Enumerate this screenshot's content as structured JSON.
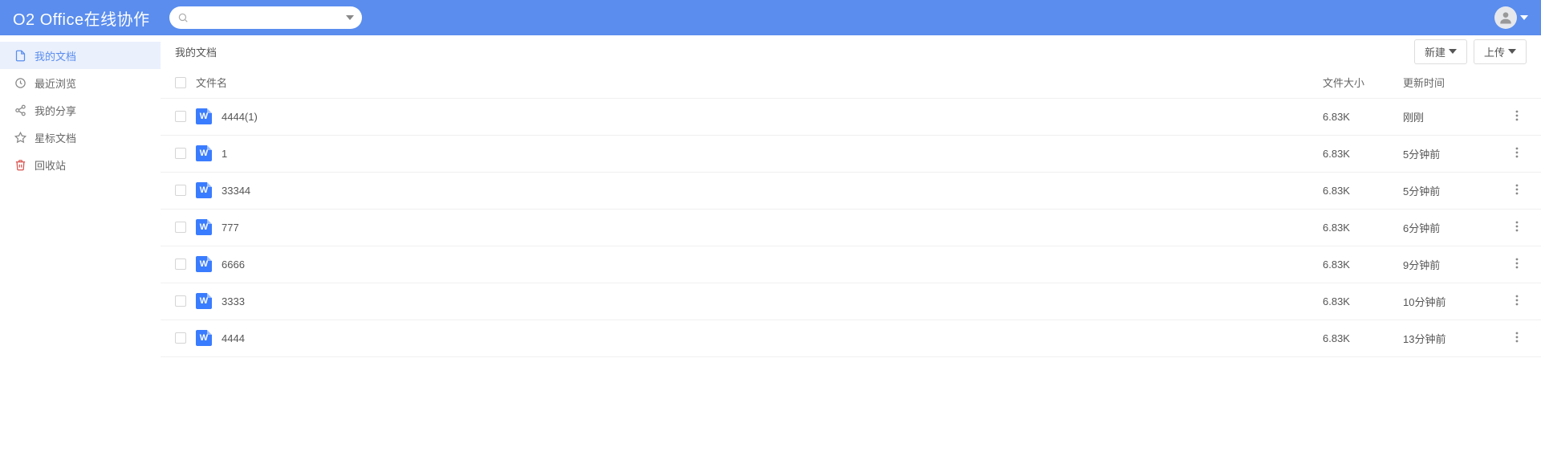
{
  "header": {
    "title": "O2 Office在线协作",
    "search_placeholder": ""
  },
  "sidebar": {
    "items": [
      {
        "label": "我的文档"
      },
      {
        "label": "最近浏览"
      },
      {
        "label": "我的分享"
      },
      {
        "label": "星标文档"
      },
      {
        "label": "回收站"
      }
    ]
  },
  "toolbar": {
    "breadcrumb": "我的文档",
    "new_label": "新建",
    "upload_label": "上传"
  },
  "table": {
    "headers": {
      "name": "文件名",
      "size": "文件大小",
      "time": "更新时间"
    },
    "rows": [
      {
        "name": "4444(1)",
        "size": "6.83K",
        "time": "刚刚"
      },
      {
        "name": "1",
        "size": "6.83K",
        "time": "5分钟前"
      },
      {
        "name": "33344",
        "size": "6.83K",
        "time": "5分钟前"
      },
      {
        "name": "777",
        "size": "6.83K",
        "time": "6分钟前"
      },
      {
        "name": "6666",
        "size": "6.83K",
        "time": "9分钟前"
      },
      {
        "name": "3333",
        "size": "6.83K",
        "time": "10分钟前"
      },
      {
        "name": "4444",
        "size": "6.83K",
        "time": "13分钟前"
      }
    ]
  }
}
